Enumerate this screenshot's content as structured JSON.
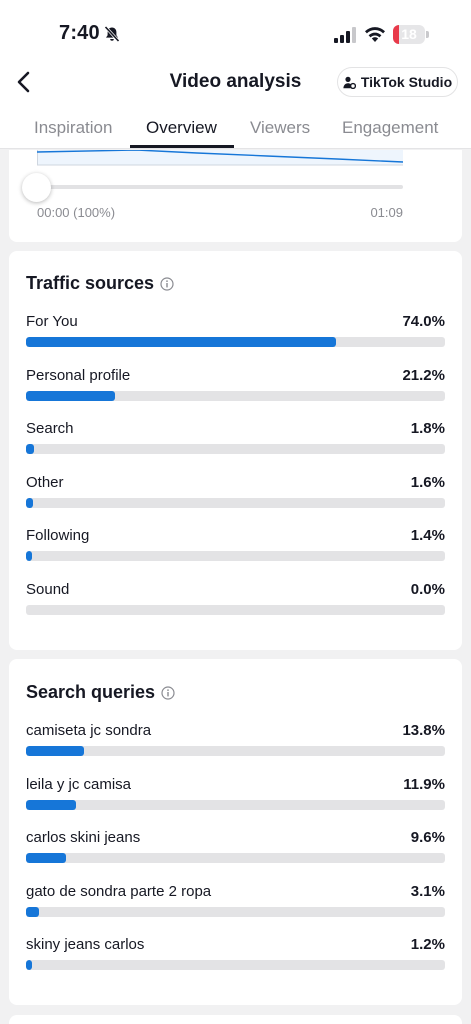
{
  "status_bar": {
    "time": "7:40",
    "battery": "18",
    "battery_level": 0.18,
    "battery_color": "#e83a4a"
  },
  "nav": {
    "title": "Video analysis",
    "studio_button": "TikTok Studio"
  },
  "tabs": [
    {
      "label": "Inspiration",
      "active": false
    },
    {
      "label": "Overview",
      "active": true
    },
    {
      "label": "Viewers",
      "active": false
    },
    {
      "label": "Engagement",
      "active": false
    }
  ],
  "retention": {
    "start_label": "00:00 (100%)",
    "end_label": "01:09",
    "slider_position": 0
  },
  "traffic_sources": {
    "title": "Traffic sources",
    "items": [
      {
        "label": "For You",
        "value": "74.0%",
        "percent": 74.0
      },
      {
        "label": "Personal profile",
        "value": "21.2%",
        "percent": 21.2
      },
      {
        "label": "Search",
        "value": "1.8%",
        "percent": 1.8
      },
      {
        "label": "Other",
        "value": "1.6%",
        "percent": 1.6
      },
      {
        "label": "Following",
        "value": "1.4%",
        "percent": 1.4
      },
      {
        "label": "Sound",
        "value": "0.0%",
        "percent": 0.0
      }
    ]
  },
  "search_queries": {
    "title": "Search queries",
    "items": [
      {
        "label": "camiseta jc sondra",
        "value": "13.8%",
        "percent": 13.8
      },
      {
        "label": "leila y jc camisa",
        "value": "11.9%",
        "percent": 11.9
      },
      {
        "label": "carlos skini jeans",
        "value": "9.6%",
        "percent": 9.6
      },
      {
        "label": "gato de sondra parte 2 ropa",
        "value": "3.1%",
        "percent": 3.1
      },
      {
        "label": "skiny jeans carlos",
        "value": "1.2%",
        "percent": 1.2
      }
    ]
  },
  "colors": {
    "accent": "#1676d8",
    "track": "#e3e3e5",
    "background": "#f1f1f2"
  }
}
